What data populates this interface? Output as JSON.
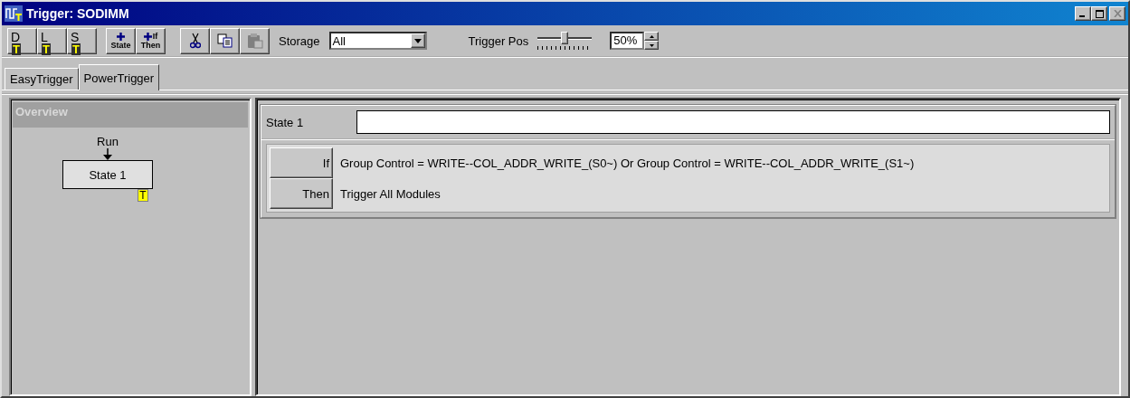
{
  "window": {
    "title": "Trigger: SODIMM",
    "buttons": [
      {
        "kind": "minimize",
        "disabled": false
      },
      {
        "kind": "maximize",
        "disabled": false
      },
      {
        "kind": "close",
        "disabled": true
      }
    ]
  },
  "toolbar": {
    "groups": [
      [
        {
          "kind": "letter",
          "label": "D$_{T}$",
          "disabled": false
        },
        {
          "kind": "letter",
          "label": "L$_{T}$",
          "disabled": false
        },
        {
          "kind": "letter",
          "label": "S$_{T}$",
          "disabled": false
        }
      ],
      [
        {
          "kind": "add-state",
          "label": "State",
          "disabled": false
        },
        {
          "kind": "add-ifthen",
          "label": "If",
          "label2": "Then",
          "disabled": false
        }
      ],
      [
        {
          "kind": "cut",
          "disabled": false
        },
        {
          "kind": "copy",
          "disabled": false
        },
        {
          "kind": "paste",
          "disabled": true
        }
      ]
    ],
    "storage": {
      "label": "Storage",
      "value": "All"
    },
    "trigger_pos": {
      "label": "Trigger Pos",
      "level": 0.5,
      "value": "50%"
    }
  },
  "tabs": [
    {
      "label": "EasyTrigger",
      "selected": false
    },
    {
      "label": "PowerTrigger",
      "selected": true
    }
  ],
  "overview": {
    "title": "Overview",
    "start": "Run",
    "states": [
      {
        "name": "State 1",
        "badge": "T"
      }
    ]
  },
  "state": {
    "name": "State 1",
    "rows": [
      {
        "keyword": "If",
        "text": "Group Control = WRITE--COL_ADDR_WRITE_(S0~) Or Group Control = WRITE--COL_ADDR_WRITE_(S1~)"
      },
      {
        "keyword": "Then",
        "text": "Trigger All Modules"
      }
    ]
  }
}
